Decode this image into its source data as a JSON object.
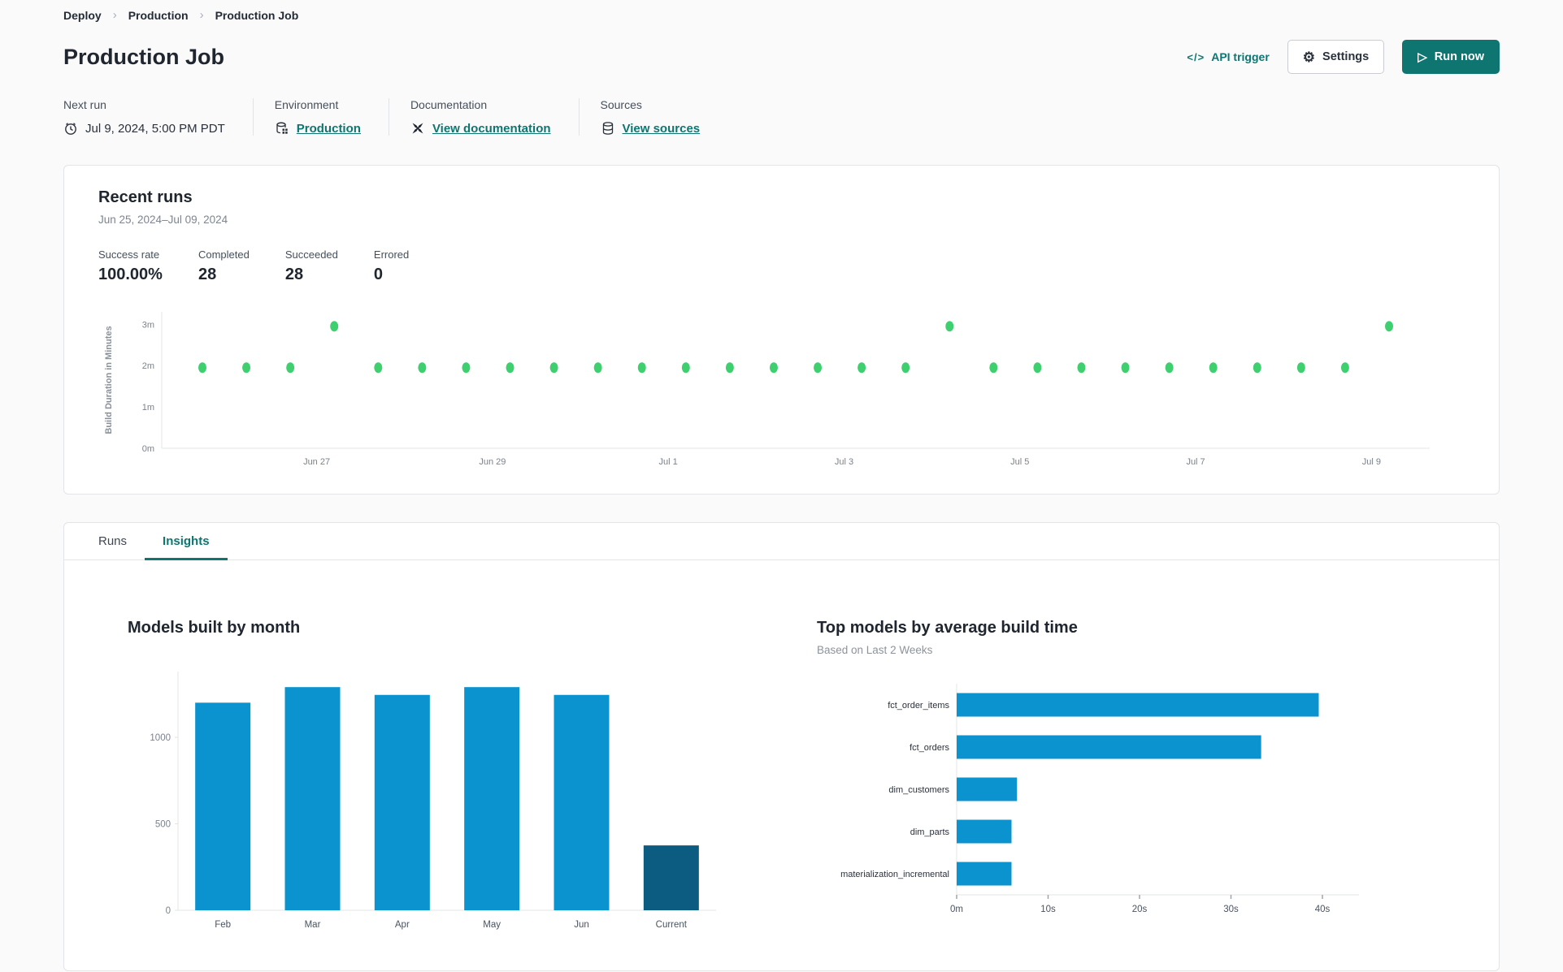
{
  "breadcrumb": {
    "items": [
      {
        "label": "Deploy"
      },
      {
        "label": "Production"
      },
      {
        "label": "Production Job"
      }
    ]
  },
  "header": {
    "title": "Production Job",
    "api_trigger_icon": "</>",
    "api_trigger_label": "API trigger",
    "settings_label": "Settings",
    "run_now_label": "Run now"
  },
  "info_bar": {
    "columns": [
      {
        "label": "Next run",
        "value": "Jul 9, 2024, 5:00 PM PDT",
        "icon": "clock-icon",
        "is_link": false
      },
      {
        "label": "Environment",
        "value": "Production",
        "icon": "environment-icon",
        "is_link": true
      },
      {
        "label": "Documentation",
        "value": "View documentation",
        "icon": "docs-icon",
        "is_link": true
      },
      {
        "label": "Sources",
        "value": "View sources",
        "icon": "database-icon",
        "is_link": true
      }
    ]
  },
  "recent_runs": {
    "title": "Recent runs",
    "date_range": "Jun 25, 2024–Jul 09, 2024",
    "stats": [
      {
        "label": "Success rate",
        "value": "100.00%"
      },
      {
        "label": "Completed",
        "value": "28"
      },
      {
        "label": "Succeeded",
        "value": "28"
      },
      {
        "label": "Errored",
        "value": "0"
      }
    ]
  },
  "tabs": [
    {
      "label": "Runs",
      "active": false
    },
    {
      "label": "Insights",
      "active": true
    }
  ],
  "colors": {
    "accent_teal": "#0e7570",
    "dot_green": "#3ecf6e",
    "bar_blue": "#0a93ce",
    "bar_dark_blue": "#0c5b80",
    "axis_gray": "#e3e4e6",
    "tick_text": "#7a828c"
  },
  "chart_data": [
    {
      "type": "scatter",
      "name": "build-duration-scatter",
      "ylabel": "Build Duration in Minutes",
      "y_ticks": [
        {
          "label": "0m",
          "v": 0
        },
        {
          "label": "1m",
          "v": 1
        },
        {
          "label": "2m",
          "v": 2
        },
        {
          "label": "3m",
          "v": 3
        }
      ],
      "ylim": [
        0,
        3.3
      ],
      "x_ticks": [
        {
          "label": "Jun 27",
          "pos": 2.6
        },
        {
          "label": "Jun 29",
          "pos": 6.6
        },
        {
          "label": "Jul 1",
          "pos": 10.6
        },
        {
          "label": "Jul 3",
          "pos": 14.6
        },
        {
          "label": "Jul 5",
          "pos": 18.6
        },
        {
          "label": "Jul 7",
          "pos": 22.6
        },
        {
          "label": "Jul 9",
          "pos": 26.6
        }
      ],
      "y_minutes": [
        1.95,
        1.95,
        1.95,
        2.95,
        1.95,
        1.95,
        1.95,
        1.95,
        1.95,
        1.95,
        1.95,
        1.95,
        1.95,
        1.95,
        1.95,
        1.95,
        1.95,
        2.95,
        1.95,
        1.95,
        1.95,
        1.95,
        1.95,
        1.95,
        1.95,
        1.95,
        1.95,
        2.95
      ],
      "point_color": "#3ecf6e"
    },
    {
      "type": "bar",
      "name": "models-built-by-month",
      "title": "Models built by month",
      "categories": [
        "Feb",
        "Mar",
        "Apr",
        "May",
        "Jun",
        "Current"
      ],
      "values": [
        1200,
        1290,
        1245,
        1290,
        1245,
        375
      ],
      "y_ticks": [
        0,
        500,
        1000
      ],
      "ylim": [
        0,
        1380
      ],
      "bar_color": "#0a93ce",
      "highlight_color": "#0c5b80",
      "highlight_index": 5
    },
    {
      "type": "hbar",
      "name": "top-models-by-avg-build-time",
      "title": "Top models by average build time",
      "subtitle": "Based on Last 2 Weeks",
      "categories": [
        "fct_order_items",
        "fct_orders",
        "dim_customers",
        "dim_parts",
        "materialization_incremental"
      ],
      "values": [
        39.6,
        33.3,
        6.6,
        6.0,
        6.0
      ],
      "x_ticks": [
        {
          "label": "0m",
          "v": 0
        },
        {
          "label": "10s",
          "v": 10
        },
        {
          "label": "20s",
          "v": 20
        },
        {
          "label": "30s",
          "v": 30
        },
        {
          "label": "40s",
          "v": 40
        }
      ],
      "xlim": [
        0,
        44
      ],
      "bar_color": "#0a93ce"
    }
  ]
}
